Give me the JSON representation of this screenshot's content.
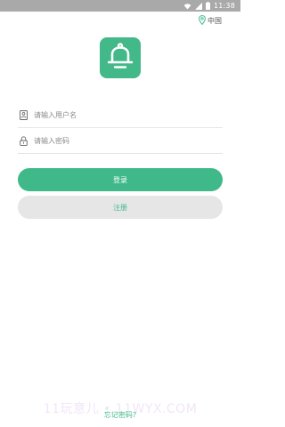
{
  "status_bar": {
    "time": "11:38",
    "icons": [
      "wifi-icon",
      "signal-icon",
      "battery-icon"
    ]
  },
  "location": {
    "icon": "map-pin-icon",
    "label": "中国"
  },
  "logo": {
    "icon": "bell-icon",
    "color": "#43b889"
  },
  "form": {
    "username": {
      "icon": "id-card-icon",
      "placeholder": "请输入用户名",
      "value": ""
    },
    "password": {
      "icon": "lock-icon",
      "placeholder": "请输入密码",
      "value": ""
    },
    "login_label": "登录",
    "register_label": "注册",
    "forgot_label": "忘记密码?"
  },
  "watermark": {
    "text": "11玩意儿 • 11WYX.COM"
  },
  "colors": {
    "accent": "#3fb98a",
    "status_bar": "#a9a9a9",
    "secondary_button": "#e6e6e6"
  }
}
